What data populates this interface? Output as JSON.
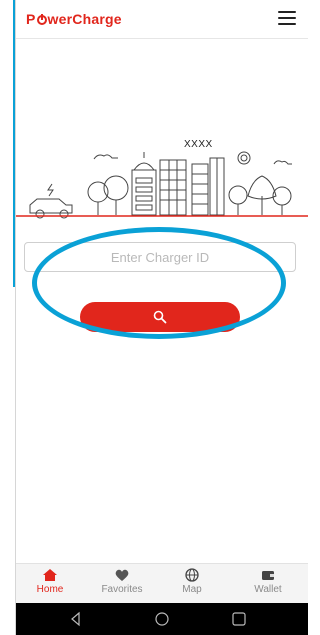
{
  "app": {
    "brand": "PowerCharge"
  },
  "illustration": {
    "sign_text": "XXXX"
  },
  "search": {
    "placeholder": "Enter Charger ID"
  },
  "bottom_nav": {
    "items": [
      {
        "label": "Home",
        "icon": "home-icon",
        "active": true
      },
      {
        "label": "Favorites",
        "icon": "heart-icon",
        "active": false
      },
      {
        "label": "Map",
        "icon": "globe-icon",
        "active": false
      },
      {
        "label": "Wallet",
        "icon": "wallet-icon",
        "active": false
      }
    ]
  },
  "colors": {
    "brand": "#e1261c",
    "callout": "#0aa1d6",
    "inactive": "#8a8a8a"
  }
}
